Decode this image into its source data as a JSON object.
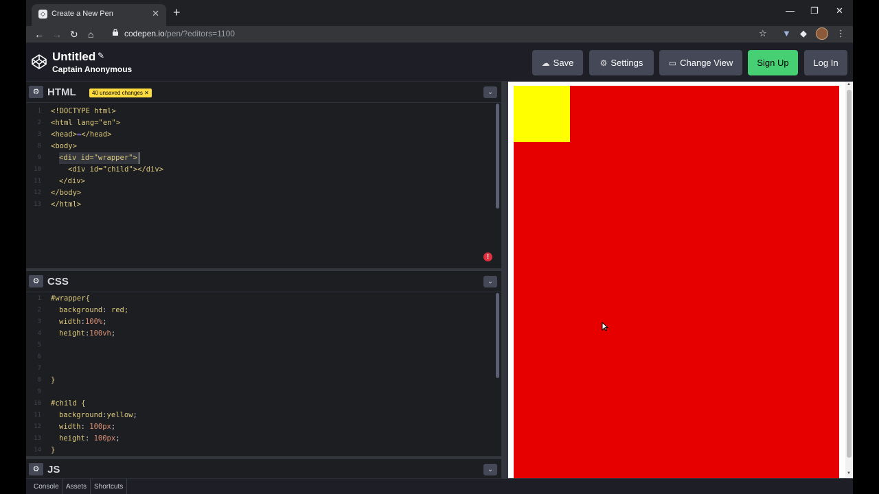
{
  "browser": {
    "tab_title": "Create a New Pen",
    "url_host": "codepen.io",
    "url_path": "/pen/?editors=1100"
  },
  "header": {
    "title": "Untitled",
    "owner": "Captain Anonymous",
    "buttons": {
      "save": "Save",
      "settings": "Settings",
      "change_view": "Change View",
      "sign_up": "Sign Up",
      "log_in": "Log In"
    }
  },
  "html_pane": {
    "title": "HTML",
    "badge": "40 unsaved changes",
    "line_numbers": [
      "1",
      "2",
      "3",
      "8",
      "9",
      "10",
      "11",
      "12",
      "13"
    ],
    "lines": {
      "l1": "<!DOCTYPE html>",
      "l2": "<html lang=\"en\">",
      "l3a": "<head>",
      "l3c": "</head>",
      "l8": "<body>",
      "l9": "<div id=\"wrapper\">",
      "l10": "<div id=\"child\"></div>",
      "l11": "</div>",
      "l12": "</body>",
      "l13": "</html>"
    }
  },
  "css_pane": {
    "title": "CSS",
    "line_numbers": [
      "1",
      "2",
      "3",
      "4",
      "5",
      "6",
      "7",
      "8",
      "9",
      "10",
      "11",
      "12",
      "13",
      "14"
    ],
    "lines": {
      "l1": "#wrapper{",
      "l2p": "background",
      "l2v": " red;",
      "l3p": "width",
      "l3v": "100%",
      "l4p": "height",
      "l4v": "100vh",
      "l8": "}",
      "l10": "#child {",
      "l11p": "background",
      "l11v": "yellow",
      "l12p": "width",
      "l12v": "100px",
      "l13p": "height",
      "l13v": "100px",
      "l14": "}"
    }
  },
  "js_pane": {
    "title": "JS"
  },
  "footer": {
    "console": "Console",
    "assets": "Assets",
    "shortcuts": "Shortcuts"
  },
  "colors": {
    "wrapper_bg": "#e60000",
    "child_bg": "#ffff00",
    "sign_up_bg": "#47cf73",
    "badge_bg": "#ffdd40"
  }
}
